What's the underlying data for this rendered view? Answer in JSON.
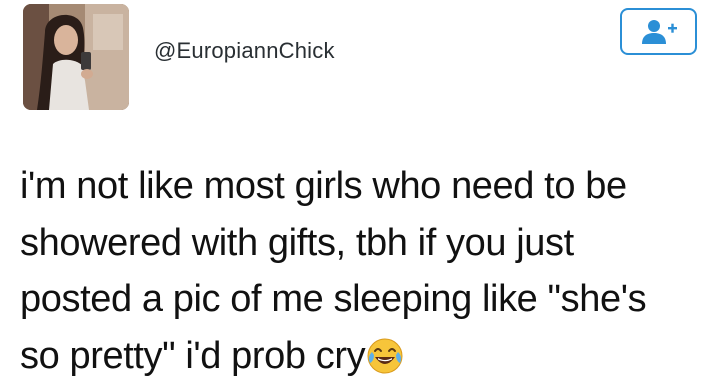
{
  "tweet": {
    "author": {
      "handle": "@EuropiannChick",
      "avatar_icon": "profile-photo"
    },
    "follow_button": {
      "icon": "add-user-icon",
      "color": "#2b8fd6"
    },
    "text_lines": [
      "i'm not like most girls who need to be",
      "showered with gifts, tbh if you just",
      "posted a pic of me sleeping like \"she's",
      "so pretty\" i'd prob cry"
    ],
    "emoji": "face-with-tears-of-joy"
  }
}
